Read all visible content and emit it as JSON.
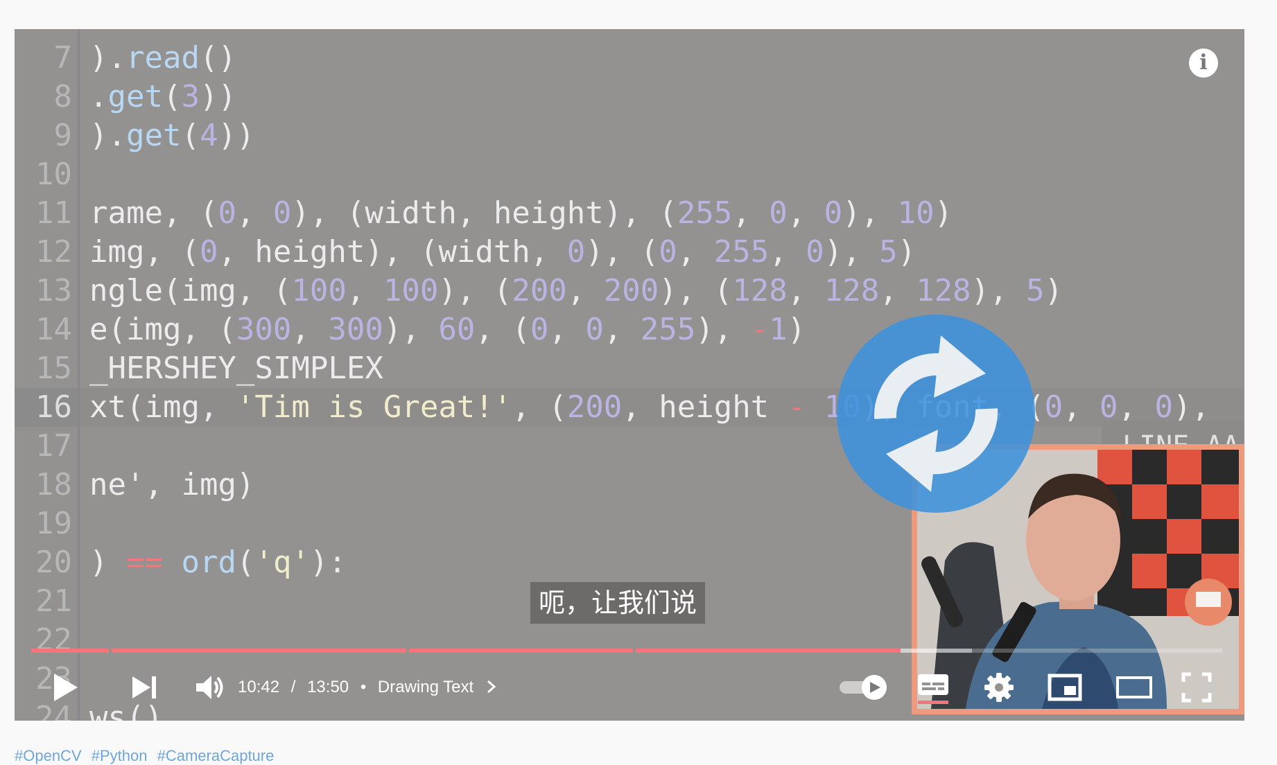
{
  "code_editor": {
    "lines": [
      {
        "num": "7",
        "text": ").read()"
      },
      {
        "num": "8",
        "text": ".get(3))"
      },
      {
        "num": "9",
        "text": ").get(4))"
      },
      {
        "num": "10",
        "text": ""
      },
      {
        "num": "11",
        "text": "rame, (0, 0), (width, height), (255, 0, 0), 10)"
      },
      {
        "num": "12",
        "text": "img, (0, height), (width, 0), (0, 255, 0), 5)"
      },
      {
        "num": "13",
        "text": "ngle(img, (100, 100), (200, 200), (128, 128, 128), 5)"
      },
      {
        "num": "14",
        "text": "e(img, (300, 300), 60, (0, 0, 255), -1)"
      },
      {
        "num": "15",
        "text": "_HERSHEY_SIMPLEX"
      },
      {
        "num": "16",
        "text": "xt(img, 'Tim is Great!', (200, height - 10), font, (0, 0, 0),"
      },
      {
        "num": "17",
        "text": ""
      },
      {
        "num": "18",
        "text": "ne', img)"
      },
      {
        "num": "19",
        "text": ""
      },
      {
        "num": "20",
        "text": ") == ord('q'):"
      },
      {
        "num": "21",
        "text": ""
      },
      {
        "num": "22",
        "text": ""
      },
      {
        "num": "23",
        "text": ""
      },
      {
        "num": "24",
        "text": "ws()"
      }
    ],
    "active_line": "16",
    "overflow_text": "LINE_AA"
  },
  "caption": "呃，让我们说",
  "player": {
    "current_time": "10:42",
    "duration": "13:50",
    "time_separator": "/",
    "chapter_dot": "•",
    "chapter": "Drawing Text",
    "progress_fraction": 0.73,
    "buffered_fraction": 0.79,
    "chapter_marks": [
      0.065,
      0.315,
      0.505
    ],
    "autoplay_on": true,
    "captions_on": true
  },
  "icons": {
    "play": "play-icon",
    "next": "skip-next-icon",
    "volume": "volume-icon",
    "autoplay": "autoplay-toggle-icon",
    "subtitles": "subtitles-icon",
    "settings": "gear-icon",
    "miniplayer": "miniplayer-icon",
    "theater": "theater-mode-icon",
    "fullscreen": "fullscreen-icon",
    "info": "info-icon",
    "overlay": "refresh-icon"
  },
  "colors": {
    "progress": "#f4757c",
    "code_number": "#b9b4e2",
    "code_string": "#f0eccc",
    "code_operator": "#f2767c",
    "code_function": "#b8d7f3",
    "refresh_blue": "#3e92dc",
    "webcam_border": "#ef9a7c",
    "tags": "#6ea6db"
  },
  "info_label": "i",
  "tags": [
    "#OpenCV",
    "#Python",
    "#CameraCapture"
  ]
}
